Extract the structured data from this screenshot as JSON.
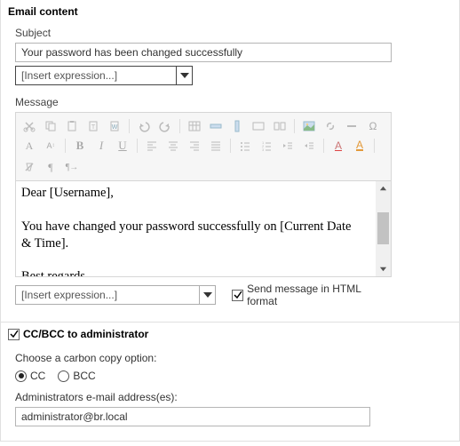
{
  "emailContent": {
    "title": "Email content",
    "subject": {
      "label": "Subject",
      "value": "Your password has been changed successfully"
    },
    "expressionSelect1": "[Insert expression...]",
    "message": {
      "label": "Message",
      "body": "Dear [Username],\n\nYou have changed your password successfully on [Current Date & Time].\n\nBest regards,"
    },
    "expressionSelect2": "[Insert expression...]",
    "htmlFormat": {
      "label": "Send message in HTML format",
      "checked": true
    }
  },
  "ccbcc": {
    "title": "CC/BCC to administrator",
    "checked": true,
    "chooseLabel": "Choose a carbon copy option:",
    "options": {
      "cc": "CC",
      "bcc": "BCC",
      "selected": "cc"
    },
    "addrLabel": "Administrators e-mail address(es):",
    "addrValue": "administrator@br.local"
  },
  "toolbar": {
    "cut": "cut-icon",
    "copy": "copy-icon",
    "paste": "paste-icon",
    "pasteText": "paste-text-icon",
    "pasteWord": "paste-word-icon",
    "undo": "undo-icon",
    "redo": "redo-icon",
    "insertTable": "table-icon",
    "insertRow": "row-icon",
    "insertCol": "col-icon",
    "mergeCell": "merge-icon",
    "splitCell": "split-icon",
    "image": "image-icon",
    "link": "link-icon",
    "hr": "hr-icon",
    "symbol": "symbol-icon",
    "fontName": "A",
    "fontSize": "A",
    "bold": "B",
    "italic": "I",
    "underline": "U",
    "alignLeft": "align-left-icon",
    "alignCenter": "align-center-icon",
    "alignRight": "align-right-icon",
    "alignJustify": "align-justify-icon",
    "ul": "ul-icon",
    "ol": "ol-icon",
    "outdent": "outdent-icon",
    "indent": "indent-icon",
    "foreColor": "fore-color-icon",
    "backColor": "back-color-icon",
    "removeFormat": "remove-format-icon",
    "para": "para-icon",
    "ltr": "ltr-icon"
  }
}
